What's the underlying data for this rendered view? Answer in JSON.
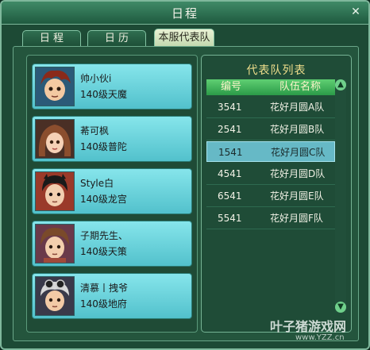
{
  "window": {
    "title": "日程"
  },
  "tabs": [
    {
      "label": "日 程"
    },
    {
      "label": "日 历"
    },
    {
      "label": "本服代表队",
      "active": true
    }
  ],
  "members": [
    {
      "name": "帅小伙i",
      "level": "140级天魔",
      "avatar": "avatar-boy-red-hair"
    },
    {
      "name": "莃可枫",
      "level": "140级普陀",
      "avatar": "avatar-girl-brown-hair"
    },
    {
      "name": "Style白",
      "level": "140级龙宫",
      "avatar": "avatar-boy-black-hair"
    },
    {
      "name": "子期先生、",
      "level": "140级天策",
      "avatar": "avatar-boy-brown-hair"
    },
    {
      "name": "清慕丨拽爷",
      "level": "140级地府",
      "avatar": "avatar-boy-goggles"
    }
  ],
  "team_list": {
    "title": "代表队列表",
    "columns": [
      "编号",
      "队伍名称"
    ],
    "rows": [
      {
        "id": "3541",
        "name": "花好月圆A队"
      },
      {
        "id": "2541",
        "name": "花好月圆B队"
      },
      {
        "id": "1541",
        "name": "花好月圆C队",
        "selected": true
      },
      {
        "id": "4541",
        "name": "花好月圆D队"
      },
      {
        "id": "6541",
        "name": "花好月圆E队"
      },
      {
        "id": "5541",
        "name": "花好月圆F队"
      }
    ]
  },
  "watermark": {
    "text": "叶子猪游戏网",
    "url": "www.YZZ.cn"
  },
  "colors": {
    "frame": "#1d4a35",
    "accent": "#f0df8c",
    "member_card": "#6fd8e0",
    "selected_row": "#66b9c6"
  }
}
